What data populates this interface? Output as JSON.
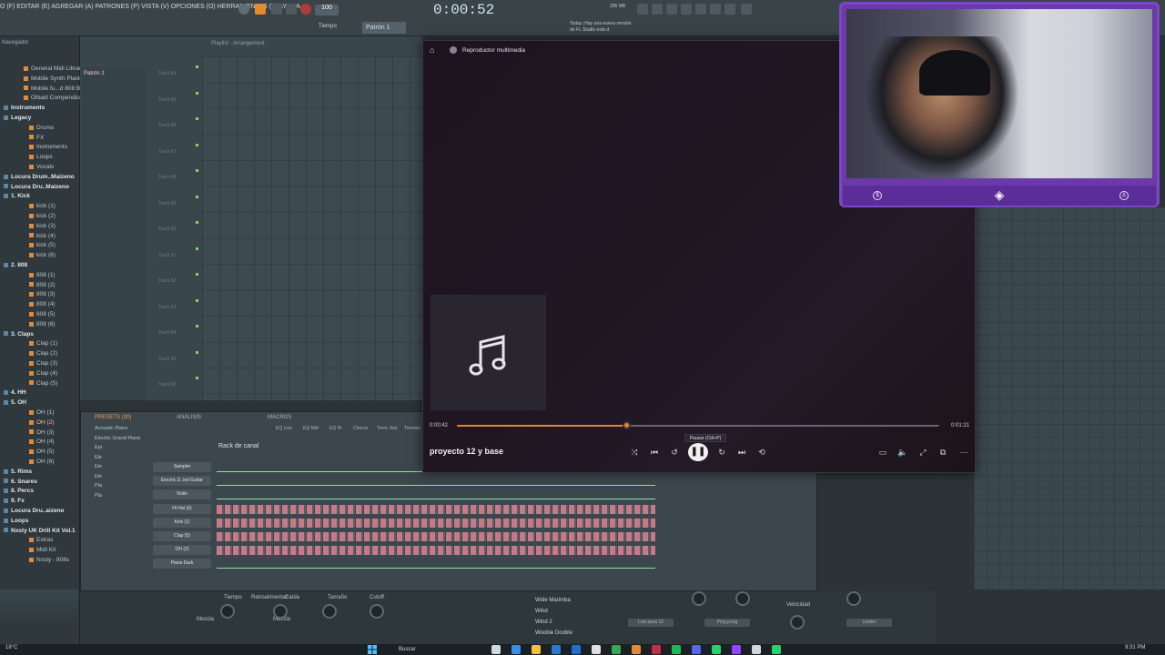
{
  "fl": {
    "menu": "O (F) EDITAR (E) AGREGAR (A) PATRONES (P) VISTA (V) OPCIONES (O) HERRAMIENTAS (T) AYUDA",
    "time": "0:00:52",
    "tempo": "100",
    "pattern": "Patrón 1",
    "tiempo_label": "Tiempo",
    "hint": "Today ¡Hay una nueva versión de FL Studio está d",
    "mem": "296 MB"
  },
  "browser": {
    "title": "Navegador",
    "items": [
      {
        "label": "General Midi Library",
        "kind": "file"
      },
      {
        "label": "Mobile Synth Plack",
        "kind": "file"
      },
      {
        "label": "Mobile fu...d 808 Bass",
        "kind": "file"
      },
      {
        "label": "Olbaid Compendium",
        "kind": "file"
      },
      {
        "label": "Instruments",
        "kind": "folder"
      },
      {
        "label": "Legacy",
        "kind": "folder"
      },
      {
        "label": "Drums",
        "kind": "sub"
      },
      {
        "label": "FX",
        "kind": "sub"
      },
      {
        "label": "Instruments",
        "kind": "sub"
      },
      {
        "label": "Loops",
        "kind": "sub"
      },
      {
        "label": "Vocals",
        "kind": "sub"
      },
      {
        "label": "Locura Drum..Maizeno",
        "kind": "folder"
      },
      {
        "label": "Locura Dru..Maizeno",
        "kind": "folder"
      },
      {
        "label": "1. Kick",
        "kind": "folder"
      },
      {
        "label": "kick (1)",
        "kind": "sub"
      },
      {
        "label": "kick (2)",
        "kind": "sub"
      },
      {
        "label": "kick (3)",
        "kind": "sub"
      },
      {
        "label": "kick (4)",
        "kind": "sub"
      },
      {
        "label": "kick (5)",
        "kind": "sub"
      },
      {
        "label": "kick (6)",
        "kind": "sub"
      },
      {
        "label": "2. 808",
        "kind": "folder"
      },
      {
        "label": "808 (1)",
        "kind": "sub"
      },
      {
        "label": "808 (2)",
        "kind": "sub"
      },
      {
        "label": "808 (3)",
        "kind": "sub"
      },
      {
        "label": "808 (4)",
        "kind": "sub"
      },
      {
        "label": "808 (5)",
        "kind": "sub"
      },
      {
        "label": "808 (6)",
        "kind": "sub"
      },
      {
        "label": "3. Claps",
        "kind": "folder"
      },
      {
        "label": "Clap (1)",
        "kind": "sub"
      },
      {
        "label": "Clap (2)",
        "kind": "sub"
      },
      {
        "label": "Clap (3)",
        "kind": "sub"
      },
      {
        "label": "Clap (4)",
        "kind": "sub"
      },
      {
        "label": "Clap (5)",
        "kind": "sub"
      },
      {
        "label": "4. HH",
        "kind": "folder"
      },
      {
        "label": "5. OH",
        "kind": "folder"
      },
      {
        "label": "OH (1)",
        "kind": "sub"
      },
      {
        "label": "OH (2)",
        "kind": "sel"
      },
      {
        "label": "OH (3)",
        "kind": "sub"
      },
      {
        "label": "OH (4)",
        "kind": "sub"
      },
      {
        "label": "OH (5)",
        "kind": "sub"
      },
      {
        "label": "OH (6)",
        "kind": "sub"
      },
      {
        "label": "5. Rims",
        "kind": "folder"
      },
      {
        "label": "6. Snares",
        "kind": "folder"
      },
      {
        "label": "8. Percs",
        "kind": "folder"
      },
      {
        "label": "9. Fx",
        "kind": "folder"
      },
      {
        "label": "Locura Dru..aizeno",
        "kind": "folder"
      },
      {
        "label": "Loops",
        "kind": "folder"
      },
      {
        "label": "Nxsty UK Drill Kit Vol.1",
        "kind": "folder"
      },
      {
        "label": "Extras",
        "kind": "sub"
      },
      {
        "label": "Midi Kit",
        "kind": "sub"
      },
      {
        "label": "Nxsty - 808s",
        "kind": "sub"
      }
    ]
  },
  "playlist": {
    "title": "Playlist - Arrangement",
    "pattern_item": "Patrón 1",
    "tracks": [
      "Track 64",
      "Track 65",
      "Track 66",
      "Track 67",
      "Track 68",
      "Track 69",
      "Track 50",
      "Track 51",
      "Track 52",
      "Track 53",
      "Track 54",
      "Track 55",
      "Track 56"
    ]
  },
  "channel_rack": {
    "title": "Rack de canal",
    "presets_label": "PRESETS (30)",
    "analisis_label": "ANÁLISIS",
    "macros_label": "MACROS",
    "fx_labels": [
      "EQ Low",
      "EQ Mid",
      "EQ Hi",
      "Chorus",
      "Trem. Rat",
      "Tremolo"
    ],
    "presets": [
      "Acoustic Piano",
      "Electric Grand Piano",
      "Epi",
      "Ele",
      "Ele",
      "Ele",
      "Pla",
      "Pla"
    ],
    "channels": [
      {
        "name": "Sampler"
      },
      {
        "name": "Electric D..ted Guitar"
      },
      {
        "name": "Violin"
      },
      {
        "name": "Hi Hat (6)"
      },
      {
        "name": "Kick (1)"
      },
      {
        "name": "Clap (5)"
      },
      {
        "name": "OH (2)"
      },
      {
        "name": "Piano Dark"
      }
    ]
  },
  "mixer": {
    "labels": [
      "Tiempo",
      "Retroalimentac",
      "Caída",
      "Tamaño",
      "Cutoff",
      "Mezcla",
      "Mezcla",
      "Velocidad"
    ],
    "preset_list": [
      "Wide Marimba",
      "Wind",
      "Wind 2",
      "Wooble Dooble"
    ],
    "buttons": [
      "Low pass 12",
      "Ping pong",
      "Limiter"
    ]
  },
  "player": {
    "title": "Reproductor multimedia",
    "song": "proyecto 12 y base",
    "current_time": "0:00:42",
    "total_time": "0:01:21",
    "progress": 0.35,
    "tooltip": "Pausar (Ctrl+P)"
  },
  "taskbar": {
    "weather": "18°C",
    "search": "Buscar",
    "clock": "9:31 PM"
  },
  "colors": {
    "accent": "#e5813a",
    "webcam_frame": "#7d46c4"
  }
}
